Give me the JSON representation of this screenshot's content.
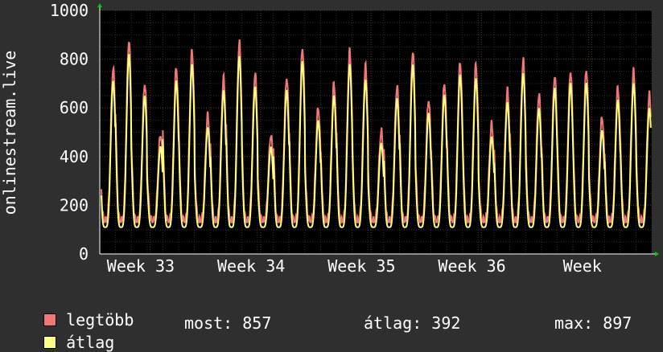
{
  "colors": {
    "background": "#2f2f2f",
    "plot_background": "#000000",
    "grid": "#3a3a3a",
    "series_max": "#f07777",
    "series_avg": "#ffff80",
    "axis_arrow": "#00cc00"
  },
  "legend": {
    "items": [
      {
        "label": "legtöbb",
        "color": "#f07777"
      },
      {
        "label": "átlag",
        "color": "#ffff80"
      }
    ]
  },
  "stats": {
    "current": "most: 857",
    "average": "átlag: 392",
    "maximum": "max: 897"
  },
  "chart_data": {
    "type": "line",
    "title": "",
    "ylabel": "onlinestream.live",
    "xlabel": "",
    "ylim": [
      0,
      1000
    ],
    "yticks": [
      0,
      200,
      400,
      600,
      800,
      1000
    ],
    "xtick_labels": [
      "Week 33",
      "Week 34",
      "Week 35",
      "Week 36",
      "Week"
    ],
    "grid": true,
    "x_unit": "day",
    "x_range": [
      0,
      35
    ],
    "series": [
      {
        "name": "legtöbb",
        "color": "#f07777",
        "key": "max"
      },
      {
        "name": "átlag",
        "color": "#ffff80",
        "key": "avg"
      }
    ],
    "daily_peaks": {
      "max": [
        820,
        870,
        770,
        570,
        790,
        840,
        650,
        600,
        650,
        900,
        910,
        870,
        580,
        880,
        940,
        880,
        580,
        870,
        700,
        930,
        940
      ],
      "avg": [
        780,
        810,
        750,
        520,
        730,
        790,
        600,
        540,
        600,
        850,
        860,
        810,
        530,
        830,
        890,
        850,
        530,
        820,
        650,
        880,
        890
      ],
      "days": [
        0.7,
        1.7,
        2.7,
        3.7,
        5.7,
        6.7,
        7.7,
        8.7,
        9.7,
        12.7,
        13.7,
        14.7,
        16.7,
        19.7,
        20.7,
        21.7,
        23.7,
        26.7,
        27.7,
        28.7,
        29.7
      ]
    },
    "weekly_pattern_peaks_max": [
      820,
      870,
      770,
      570,
      790,
      840,
      650
    ],
    "note_series_values_sampled": true,
    "last_values": {
      "max": 885,
      "avg": 857
    }
  }
}
